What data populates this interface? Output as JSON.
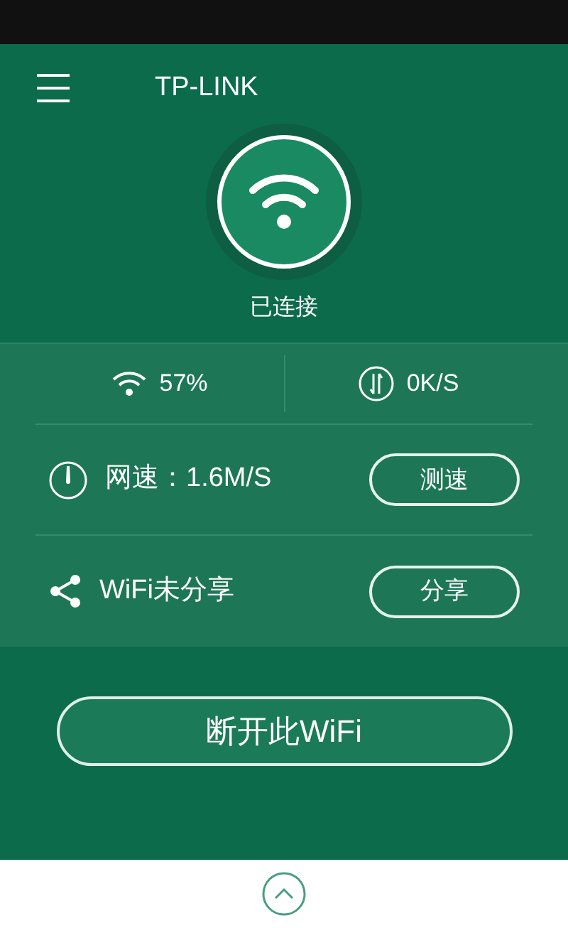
{
  "header": {
    "title": "TP-LINK"
  },
  "connection": {
    "status": "已连接"
  },
  "stats": [
    {
      "kind": "signal",
      "text": "57%"
    },
    {
      "kind": "throughput",
      "text": "0K/S"
    }
  ],
  "rows": [
    {
      "kind": "speed",
      "label": "网速：1.6M/S",
      "button": "测速"
    },
    {
      "kind": "share",
      "label": "WiFi未分享",
      "button": "分享"
    }
  ],
  "disconnect_button": "断开此WiFi"
}
